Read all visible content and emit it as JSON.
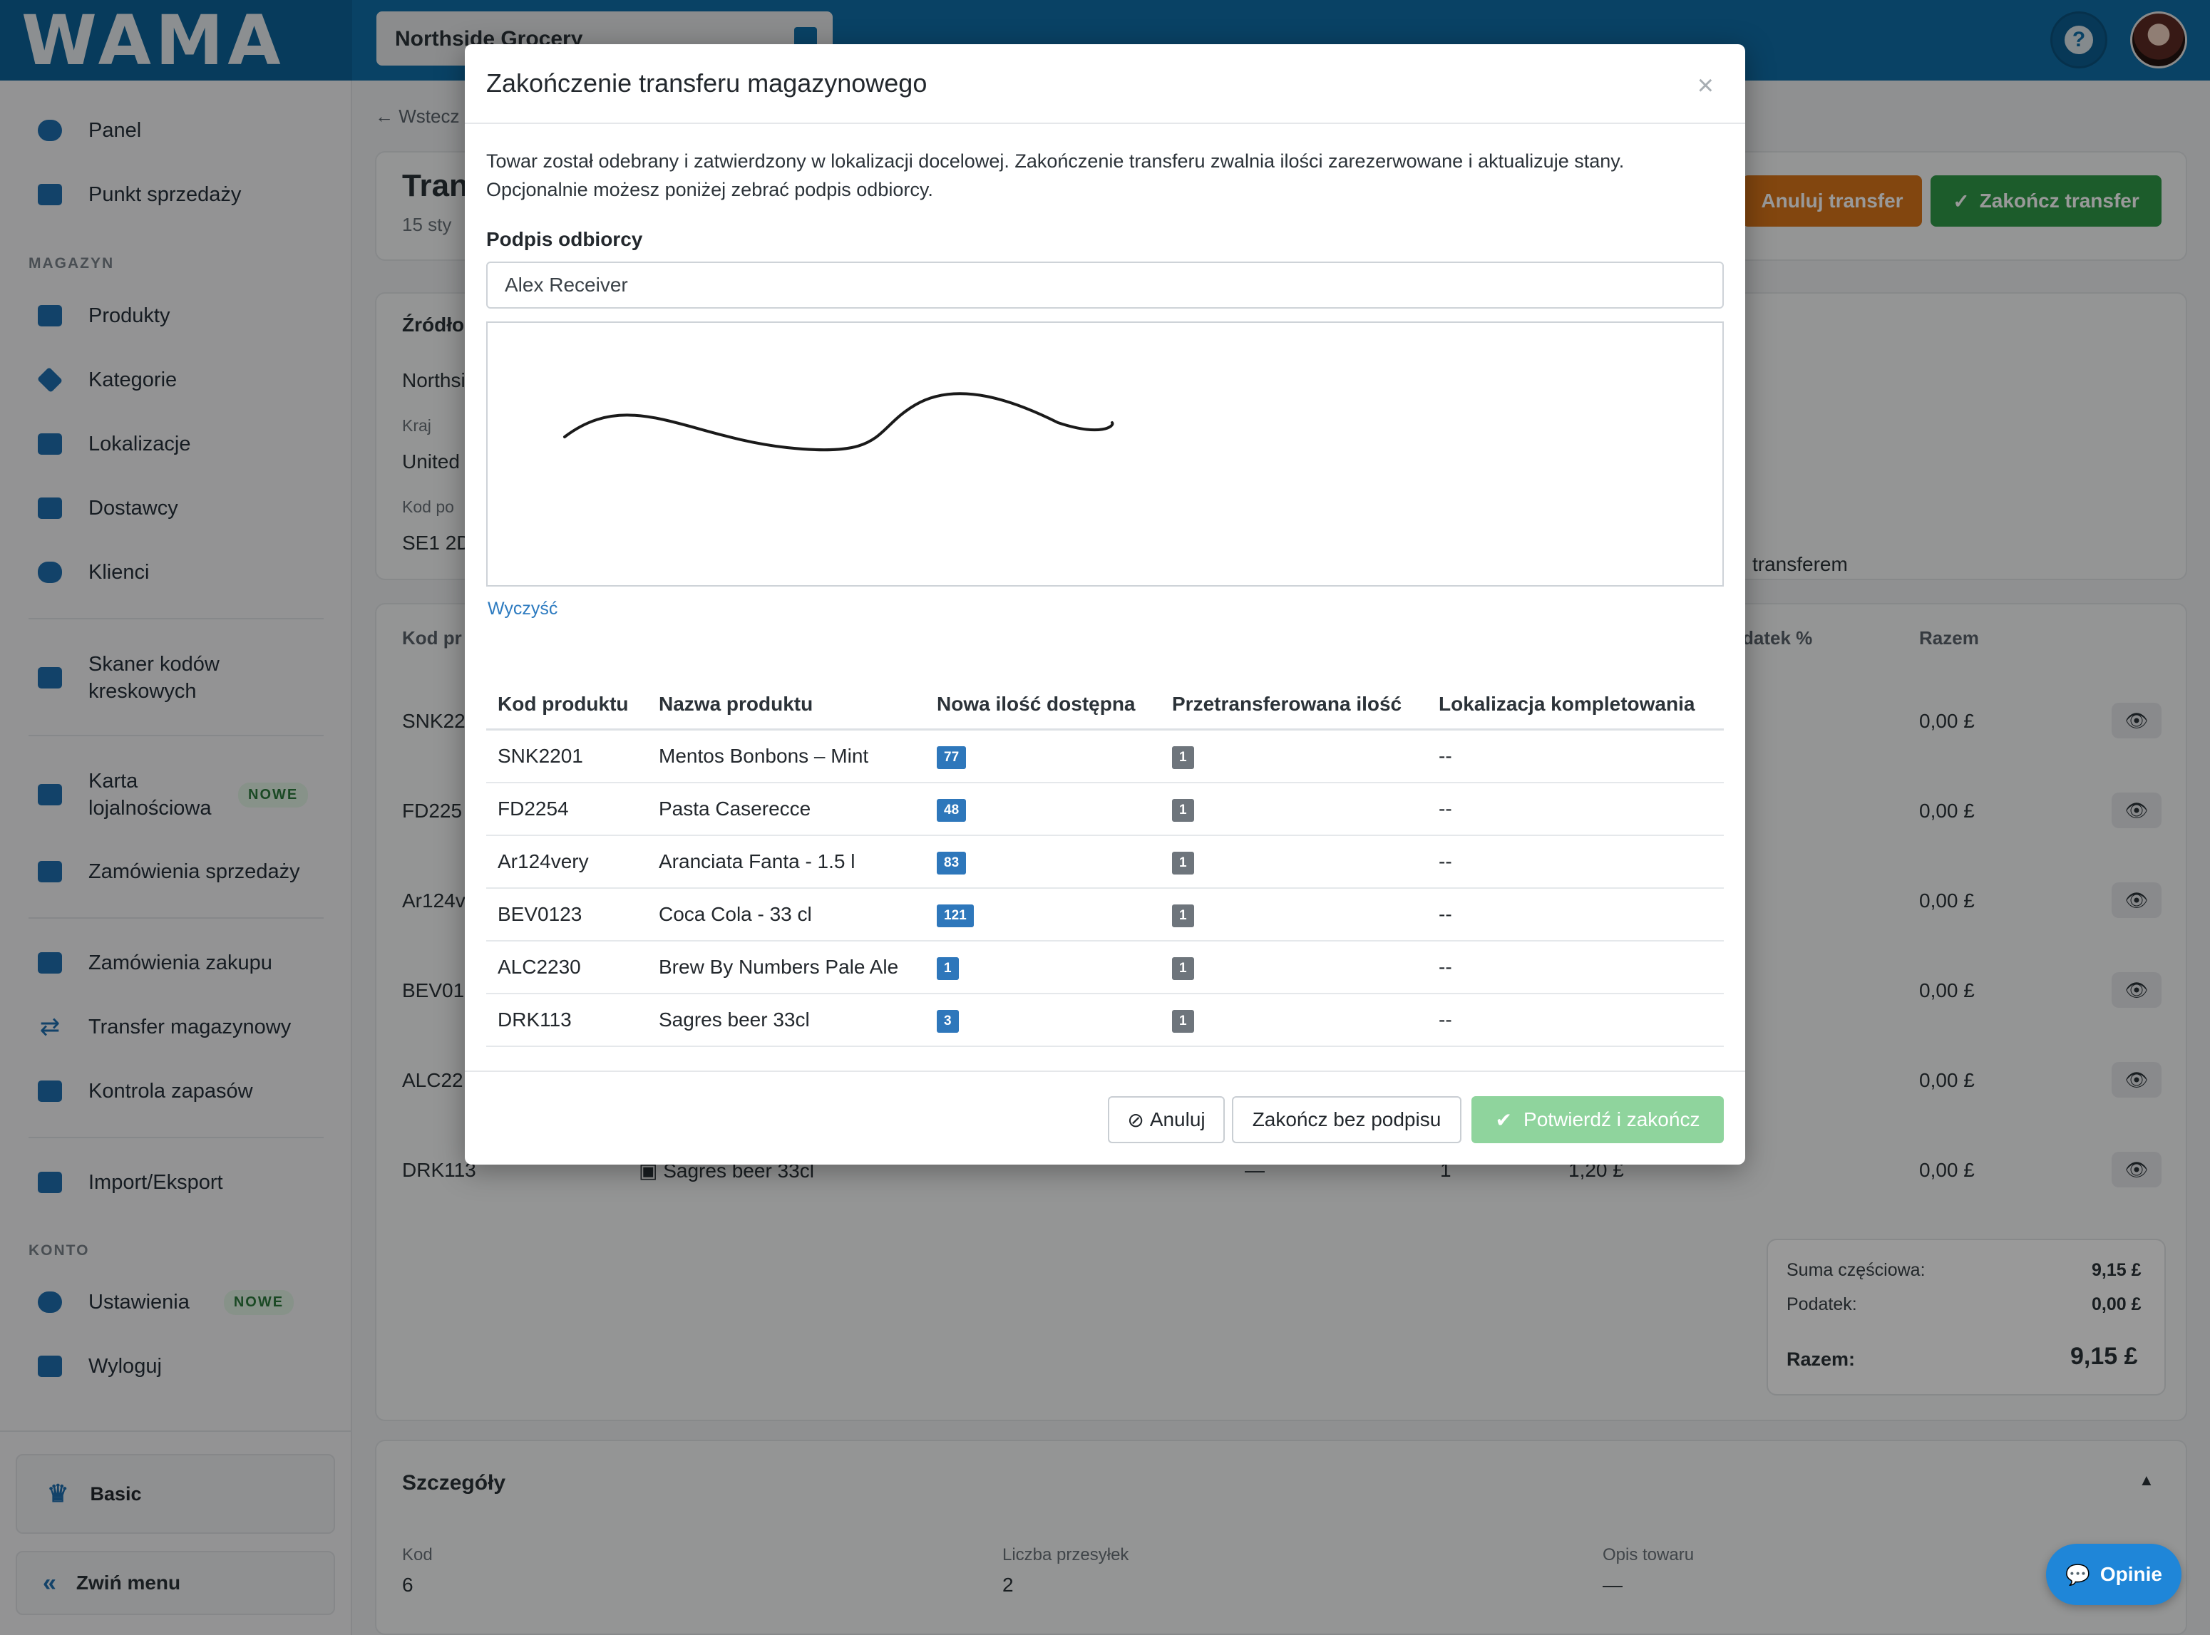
{
  "app": {
    "logo": "WAMA",
    "store": "Northside Grocery"
  },
  "sidebar": {
    "items": [
      {
        "label": "Panel",
        "icon": "gauge-icon"
      },
      {
        "label": "Punkt sprzedaży",
        "icon": "register-icon"
      }
    ],
    "section_magazyn": "MAGAZYN",
    "magazyn_items": [
      {
        "label": "Produkty",
        "icon": "box-icon"
      },
      {
        "label": "Kategorie",
        "icon": "tags-icon"
      },
      {
        "label": "Lokalizacje",
        "icon": "warehouse-icon"
      },
      {
        "label": "Dostawcy",
        "icon": "truck-icon"
      },
      {
        "label": "Klienci",
        "icon": "users-icon"
      }
    ],
    "scanner": "Skaner kodów kreskowych",
    "loyalty": "Karta lojalnościowa",
    "loyalty_badge": "NOWE",
    "sales_orders": "Zamówienia sprzedaży",
    "purchase_orders": "Zamówienia zakupu",
    "stock_transfer": "Transfer magazynowy",
    "stock_control": "Kontrola zapasów",
    "import_export": "Import/Eksport",
    "section_konto": "KONTO",
    "settings": "Ustawienia",
    "settings_badge": "NOWE",
    "logout": "Wyloguj",
    "plan": "Basic",
    "collapse": "Zwiń menu"
  },
  "background": {
    "back": "Wstecz",
    "title_partial": "Tran",
    "date_partial": "15 sty",
    "cancel_transfer": "Anuluj transfer",
    "complete_transfer": "Zakończ transfer",
    "source_partial": "Źródło",
    "source_name_partial": "Northsi",
    "country_label": "Kraj",
    "country_partial": "United",
    "postcode_label_partial": "Kod po",
    "postcode_partial": "SE1 2D",
    "transfer_note_partial": "transferem",
    "col_code_partial": "Kod pr",
    "col_tax_partial": "datek %",
    "col_total": "Razem",
    "rows": [
      {
        "code": "SNK22",
        "total": "0,00 £"
      },
      {
        "code": "FD225",
        "total": "0,00 £"
      },
      {
        "code": "Ar124v",
        "total": "0,00 £"
      },
      {
        "code": "BEV01",
        "total": "0,00 £"
      },
      {
        "code": "ALC22",
        "total": "0,00 £"
      },
      {
        "code": "DRK113",
        "total": "0,00 £",
        "name": "Sagres beer 33cl",
        "qty": "1",
        "price": "1,20 £",
        "dash": "—"
      }
    ],
    "subtotal_label": "Suma częściowa:",
    "subtotal_value": "9,15 £",
    "tax_label": "Podatek:",
    "tax_value": "0,00 £",
    "total_label": "Razem:",
    "total_value": "9,15 £",
    "details_title": "Szczegóły",
    "details": [
      {
        "label": "Kod",
        "value": "6"
      },
      {
        "label": "Liczba przesyłek",
        "value": "2"
      },
      {
        "label": "Opis towaru",
        "value": "—"
      }
    ],
    "feedback": "Opinie"
  },
  "modal": {
    "title": "Zakończenie transferu magazynowego",
    "close": "×",
    "description_line1": "Towar został odebrany i zatwierdzony w lokalizacji docelowej. Zakończenie transferu zwalnia ilości zarezerwowane i aktualizuje stany.",
    "description_line2": "Opcjonalnie możesz poniżej zebrać podpis odbiorcy.",
    "signature_label": "Podpis odbiorcy",
    "signer_name": "Alex Receiver",
    "clear": "Wyczyść",
    "columns": [
      "Kod produktu",
      "Nazwa produktu",
      "Nowa ilość dostępna",
      "Przetransferowana ilość",
      "Lokalizacja kompletowania"
    ],
    "rows": [
      {
        "code": "SNK2201",
        "name": "Mentos Bonbons – Mint",
        "available": "77",
        "transferred": "1",
        "location": "--"
      },
      {
        "code": "FD2254",
        "name": "Pasta Caserecce",
        "available": "48",
        "transferred": "1",
        "location": "--"
      },
      {
        "code": "Ar124very",
        "name": "Aranciata Fanta - 1.5 l",
        "available": "83",
        "transferred": "1",
        "location": "--"
      },
      {
        "code": "BEV0123",
        "name": "Coca Cola - 33 cl",
        "available": "121",
        "transferred": "1",
        "location": "--"
      },
      {
        "code": "ALC2230",
        "name": "Brew By Numbers Pale Ale",
        "available": "1",
        "transferred": "1",
        "location": "--"
      },
      {
        "code": "DRK113",
        "name": "Sagres beer 33cl",
        "available": "3",
        "transferred": "1",
        "location": "--"
      }
    ],
    "cancel": "Anuluj",
    "finish_no_signature": "Zakończ bez podpisu",
    "confirm": "Potwierdź i zakończ"
  },
  "colors": {
    "brand": "#0f6fa8",
    "accent_blue": "#2e77bb",
    "success": "#2f9a48",
    "warning": "#d9761a"
  }
}
